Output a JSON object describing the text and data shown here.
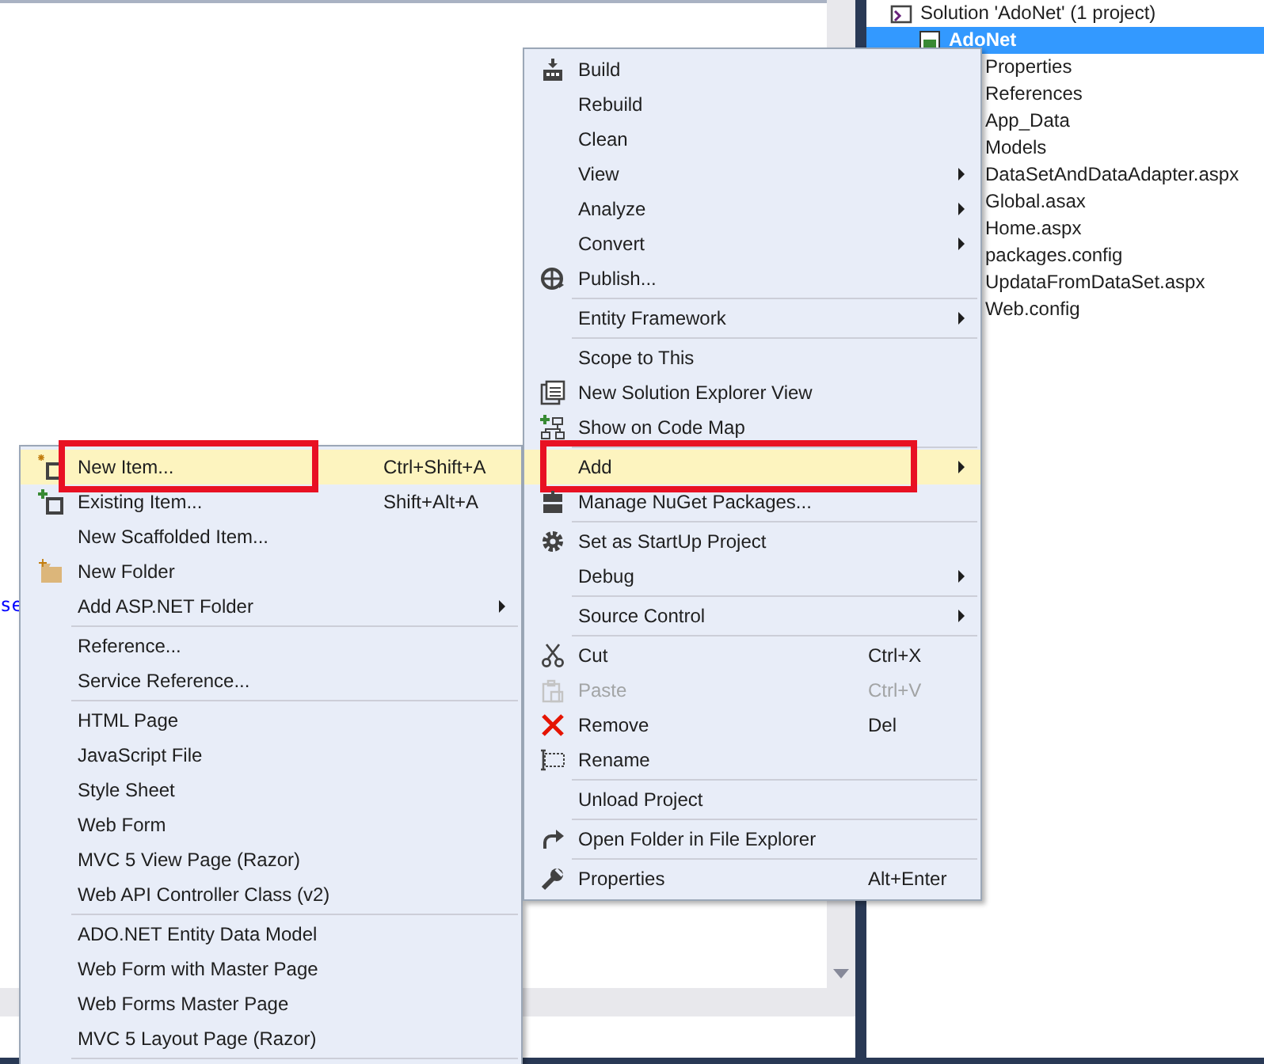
{
  "editor": {
    "code_text": "se"
  },
  "solution_explorer": {
    "items": [
      {
        "label": "Solution 'AdoNet' (1 project)",
        "selected": false,
        "children": [
          {
            "label": "AdoNet",
            "selected": true,
            "children": [
              {
                "label": "Properties",
                "selected": false
              },
              {
                "label": "References",
                "selected": false
              },
              {
                "label": "App_Data",
                "selected": false
              },
              {
                "label": "Models",
                "selected": false
              },
              {
                "label": "DataSetAndDataAdapter.aspx",
                "selected": false
              },
              {
                "label": "Global.asax",
                "selected": false
              },
              {
                "label": "Home.aspx",
                "selected": false
              },
              {
                "label": "packages.config",
                "selected": false
              },
              {
                "label": "UpdataFromDataSet.aspx",
                "selected": false
              },
              {
                "label": "Web.config",
                "selected": false
              }
            ]
          }
        ]
      }
    ]
  },
  "add_submenu": {
    "items": [
      {
        "kind": "item",
        "label": "New Item...",
        "shortcut": "Ctrl+Shift+A",
        "submenu": false,
        "selected": true,
        "disabled": false,
        "annotated": true
      },
      {
        "kind": "item",
        "label": "Existing Item...",
        "shortcut": "Shift+Alt+A",
        "submenu": false,
        "selected": false,
        "disabled": false,
        "annotated": false
      },
      {
        "kind": "item",
        "label": "New Scaffolded Item...",
        "submenu": false,
        "selected": false,
        "disabled": false,
        "annotated": false
      },
      {
        "kind": "item",
        "label": "New Folder",
        "submenu": false,
        "selected": false,
        "disabled": false,
        "annotated": false
      },
      {
        "kind": "item",
        "label": "Add ASP.NET Folder",
        "submenu": true,
        "selected": false,
        "disabled": false,
        "annotated": false
      },
      {
        "kind": "separator"
      },
      {
        "kind": "item",
        "label": "Reference...",
        "submenu": false,
        "selected": false,
        "disabled": false,
        "annotated": false
      },
      {
        "kind": "item",
        "label": "Service Reference...",
        "submenu": false,
        "selected": false,
        "disabled": false,
        "annotated": false
      },
      {
        "kind": "separator"
      },
      {
        "kind": "item",
        "label": "HTML Page",
        "submenu": false,
        "selected": false,
        "disabled": false,
        "annotated": false
      },
      {
        "kind": "item",
        "label": "JavaScript File",
        "submenu": false,
        "selected": false,
        "disabled": false,
        "annotated": false
      },
      {
        "kind": "item",
        "label": "Style Sheet",
        "submenu": false,
        "selected": false,
        "disabled": false,
        "annotated": false
      },
      {
        "kind": "item",
        "label": "Web Form",
        "submenu": false,
        "selected": false,
        "disabled": false,
        "annotated": false
      },
      {
        "kind": "item",
        "label": "MVC 5 View Page (Razor)",
        "submenu": false,
        "selected": false,
        "disabled": false,
        "annotated": false
      },
      {
        "kind": "item",
        "label": "Web API Controller Class (v2)",
        "submenu": false,
        "selected": false,
        "disabled": false,
        "annotated": false
      },
      {
        "kind": "separator"
      },
      {
        "kind": "item",
        "label": "ADO.NET Entity Data Model",
        "submenu": false,
        "selected": false,
        "disabled": false,
        "annotated": false
      },
      {
        "kind": "item",
        "label": "Web Form with Master Page",
        "submenu": false,
        "selected": false,
        "disabled": false,
        "annotated": false
      },
      {
        "kind": "item",
        "label": "Web Forms Master Page",
        "submenu": false,
        "selected": false,
        "disabled": false,
        "annotated": false
      },
      {
        "kind": "item",
        "label": "MVC 5 Layout Page (Razor)",
        "submenu": false,
        "selected": false,
        "disabled": false,
        "annotated": false
      },
      {
        "kind": "separator"
      }
    ]
  },
  "context_menu": {
    "items": [
      {
        "kind": "item",
        "label": "Build",
        "submenu": false,
        "selected": false,
        "disabled": false,
        "annotated": false
      },
      {
        "kind": "item",
        "label": "Rebuild",
        "submenu": false,
        "selected": false,
        "disabled": false,
        "annotated": false
      },
      {
        "kind": "item",
        "label": "Clean",
        "submenu": false,
        "selected": false,
        "disabled": false,
        "annotated": false
      },
      {
        "kind": "item",
        "label": "View",
        "submenu": true,
        "selected": false,
        "disabled": false,
        "annotated": false
      },
      {
        "kind": "item",
        "label": "Analyze",
        "submenu": true,
        "selected": false,
        "disabled": false,
        "annotated": false
      },
      {
        "kind": "item",
        "label": "Convert",
        "submenu": true,
        "selected": false,
        "disabled": false,
        "annotated": false
      },
      {
        "kind": "item",
        "label": "Publish...",
        "submenu": false,
        "selected": false,
        "disabled": false,
        "annotated": false
      },
      {
        "kind": "separator"
      },
      {
        "kind": "item",
        "label": "Entity Framework",
        "submenu": true,
        "selected": false,
        "disabled": false,
        "annotated": false
      },
      {
        "kind": "separator"
      },
      {
        "kind": "item",
        "label": "Scope to This",
        "submenu": false,
        "selected": false,
        "disabled": false,
        "annotated": false
      },
      {
        "kind": "item",
        "label": "New Solution Explorer View",
        "submenu": false,
        "selected": false,
        "disabled": false,
        "annotated": false
      },
      {
        "kind": "item",
        "label": "Show on Code Map",
        "submenu": false,
        "selected": false,
        "disabled": false,
        "annotated": false
      },
      {
        "kind": "separator"
      },
      {
        "kind": "item",
        "label": "Add",
        "submenu": true,
        "selected": true,
        "disabled": false,
        "annotated": true
      },
      {
        "kind": "item",
        "label": "Manage NuGet Packages...",
        "submenu": false,
        "selected": false,
        "disabled": false,
        "annotated": false
      },
      {
        "kind": "separator"
      },
      {
        "kind": "item",
        "label": "Set as StartUp Project",
        "submenu": false,
        "selected": false,
        "disabled": false,
        "annotated": false
      },
      {
        "kind": "item",
        "label": "Debug",
        "submenu": true,
        "selected": false,
        "disabled": false,
        "annotated": false
      },
      {
        "kind": "separator"
      },
      {
        "kind": "item",
        "label": "Source Control",
        "submenu": true,
        "selected": false,
        "disabled": false,
        "annotated": false
      },
      {
        "kind": "separator"
      },
      {
        "kind": "item",
        "label": "Cut",
        "shortcut": "Ctrl+X",
        "submenu": false,
        "selected": false,
        "disabled": false,
        "annotated": false
      },
      {
        "kind": "item",
        "label": "Paste",
        "shortcut": "Ctrl+V",
        "submenu": false,
        "selected": false,
        "disabled": true,
        "annotated": false
      },
      {
        "kind": "item",
        "label": "Remove",
        "shortcut": "Del",
        "submenu": false,
        "selected": false,
        "disabled": false,
        "annotated": false
      },
      {
        "kind": "item",
        "label": "Rename",
        "submenu": false,
        "selected": false,
        "disabled": false,
        "annotated": false
      },
      {
        "kind": "separator"
      },
      {
        "kind": "item",
        "label": "Unload Project",
        "submenu": false,
        "selected": false,
        "disabled": false,
        "annotated": false
      },
      {
        "kind": "separator"
      },
      {
        "kind": "item",
        "label": "Open Folder in File Explorer",
        "submenu": false,
        "selected": false,
        "disabled": false,
        "annotated": false
      },
      {
        "kind": "separator"
      },
      {
        "kind": "item",
        "label": "Properties",
        "shortcut": "Alt+Enter",
        "submenu": false,
        "selected": false,
        "disabled": false,
        "annotated": false
      }
    ]
  }
}
